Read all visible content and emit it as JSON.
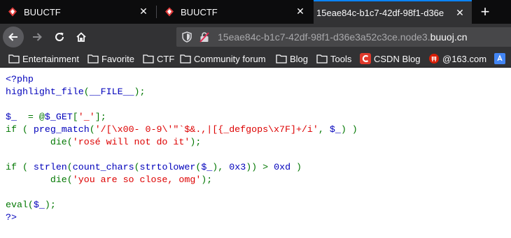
{
  "browser": {
    "tabs": [
      {
        "title": "BUUCTF",
        "active": false
      },
      {
        "title": "BUUCTF",
        "active": false
      },
      {
        "title": "15eae84c-b1c7-42df-98f1-d36e",
        "active": true
      }
    ],
    "url": {
      "path": "15eae84c-b1c7-42df-98f1-d36e3a52c3ce.node3.",
      "domain": "buuoj.cn"
    },
    "bookmarks": [
      {
        "label": "Entertainment",
        "icon": "folder-icon"
      },
      {
        "label": "Favorite",
        "icon": "folder-icon"
      },
      {
        "label": "CTF",
        "icon": "folder-icon"
      },
      {
        "label": "Community forum",
        "icon": "folder-icon"
      },
      {
        "label": "Blog",
        "icon": "folder-icon"
      },
      {
        "label": "Tools",
        "icon": "folder-icon"
      },
      {
        "label": "CSDN Blog",
        "icon": "csdn-icon"
      },
      {
        "label": "@163.com",
        "icon": "163-icon"
      }
    ],
    "colors": {
      "tabbar": "#0c0c0d",
      "toolbar": "#323234",
      "accent": "#0a84ff",
      "php_default": "#0000BB",
      "php_keyword": "#007700",
      "php_string": "#DD0000"
    }
  },
  "source": {
    "l1": "<?php",
    "l2_fn": "highlight_file",
    "l2_p1": "(",
    "l2_arg": "__FILE__",
    "l2_p2": ");",
    "l4_var": "$_ ",
    "l4_op": " = @",
    "l4_get": "$_GET",
    "l4_b1": "[",
    "l4_key": "'_'",
    "l4_b2": "];",
    "l5_if": "if ( ",
    "l5_fn": "preg_match",
    "l5_p": "(",
    "l5_re": "'/[\\x00- 0-9\\'\"`$&.,|[{_defgops\\x7F]+/i'",
    "l5_c": ", ",
    "l5_var": "$_",
    "l5_e": ") )",
    "l6_die": "die(",
    "l6_msg": "'rosé will not do it'",
    "l6_end": ");",
    "l8_if": "if ( ",
    "l8_f1": "strlen",
    "l8_p1": "(",
    "l8_f2": "count_chars",
    "l8_p2": "(",
    "l8_f3": "strtolower",
    "l8_p3": "(",
    "l8_var": "$_",
    "l8_c": "), ",
    "l8_n1": "0x3",
    "l8_gt": ")) > ",
    "l8_n2": "0xd",
    "l8_e": " )",
    "l9_die": "die(",
    "l9_msg": "'you are so close, omg'",
    "l9_end": ");",
    "l11_eval": "eval(",
    "l11_var": "$_",
    "l11_end": ");",
    "l12": "?>"
  }
}
